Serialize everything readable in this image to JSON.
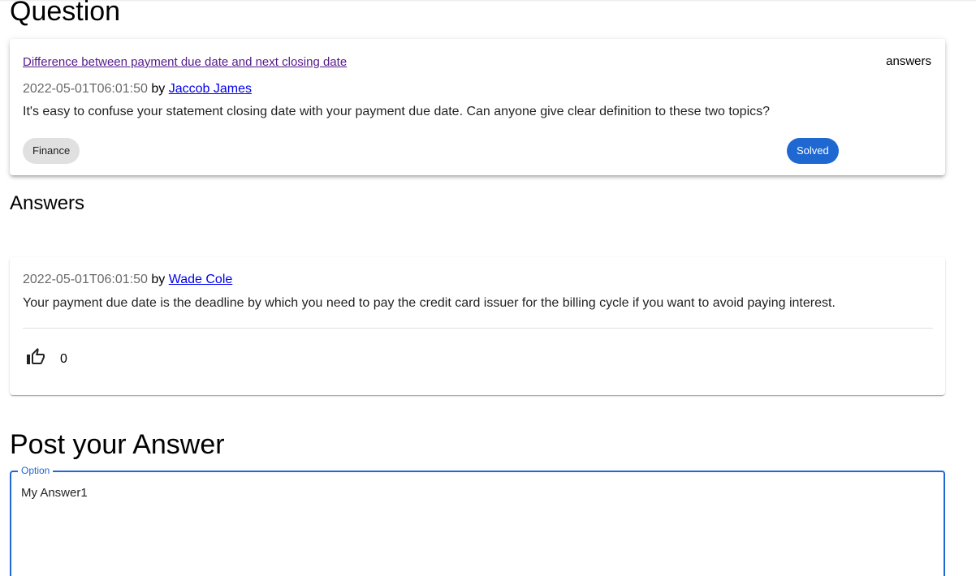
{
  "colors": {
    "link_visited": "#551a8b",
    "link": "#0000ee",
    "primary": "#1f68d2",
    "chip_default": "#e0e0e0"
  },
  "question": {
    "heading": "Question",
    "title": "Difference between payment due date and next closing date",
    "answers_label": "answers",
    "date": "2022-05-01T06:01:50",
    "by": "by",
    "author": "Jaccob James",
    "body": "It's easy to confuse your statement closing date with your payment due date. Can anyone give clear definition to these two topics?",
    "topic": "Finance",
    "status": "Solved"
  },
  "answers": {
    "heading": "Answers",
    "items": [
      {
        "date": "2022-05-01T06:01:50",
        "by": "by",
        "author": "Wade Cole",
        "body": "Your payment due date is the deadline by which you need to pay the credit card issuer for the billing cycle if you want to avoid paying interest.",
        "like_icon": "thumb-up-outline-icon",
        "likes": "0"
      }
    ]
  },
  "post_answer": {
    "heading": "Post your Answer",
    "field_label": "Option",
    "field_value": "My Answer1"
  }
}
